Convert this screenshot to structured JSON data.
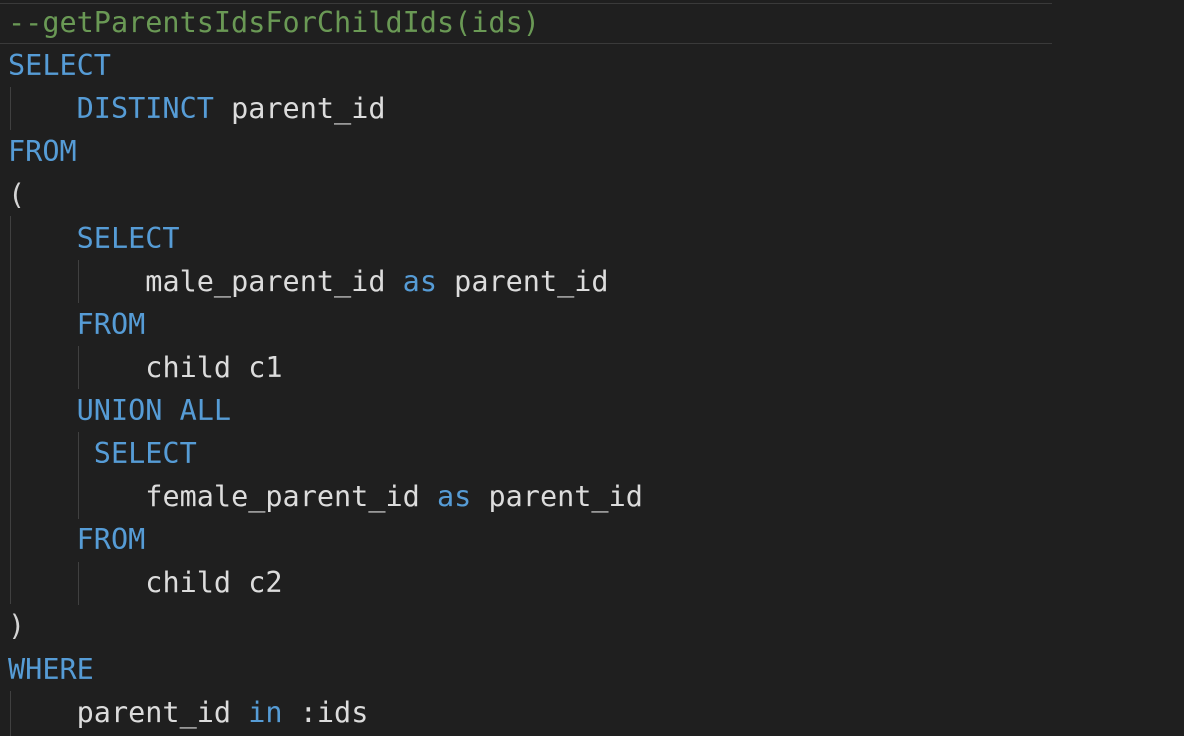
{
  "editor": {
    "language": "sql",
    "colors": {
      "background": "#1f1f1f",
      "keyword": "#569cd6",
      "comment": "#6a9955",
      "identifier": "#dcdcdc",
      "indent_guide": "#404040"
    },
    "lines": [
      {
        "tokens": [
          {
            "type": "comment",
            "text": "--getParentsIdsForChildIds(ids)"
          }
        ]
      },
      {
        "tokens": [
          {
            "type": "kw",
            "text": "SELECT"
          }
        ]
      },
      {
        "tokens": [
          {
            "type": "ws",
            "text": "    "
          },
          {
            "type": "kw",
            "text": "DISTINCT"
          },
          {
            "type": "id",
            "text": " parent_id"
          }
        ]
      },
      {
        "tokens": [
          {
            "type": "kw",
            "text": "FROM"
          }
        ]
      },
      {
        "tokens": [
          {
            "type": "punc",
            "text": "("
          }
        ]
      },
      {
        "tokens": [
          {
            "type": "ws",
            "text": "    "
          },
          {
            "type": "kw",
            "text": "SELECT"
          }
        ]
      },
      {
        "tokens": [
          {
            "type": "ws",
            "text": "        "
          },
          {
            "type": "id",
            "text": "male_parent_id "
          },
          {
            "type": "kw",
            "text": "as"
          },
          {
            "type": "id",
            "text": " parent_id"
          }
        ]
      },
      {
        "tokens": [
          {
            "type": "ws",
            "text": "    "
          },
          {
            "type": "kw",
            "text": "FROM"
          }
        ]
      },
      {
        "tokens": [
          {
            "type": "ws",
            "text": "        "
          },
          {
            "type": "id",
            "text": "child c1"
          }
        ]
      },
      {
        "tokens": [
          {
            "type": "ws",
            "text": "    "
          },
          {
            "type": "kw",
            "text": "UNION ALL"
          }
        ]
      },
      {
        "tokens": [
          {
            "type": "ws",
            "text": "     "
          },
          {
            "type": "kw",
            "text": "SELECT"
          }
        ]
      },
      {
        "tokens": [
          {
            "type": "ws",
            "text": "        "
          },
          {
            "type": "id",
            "text": "female_parent_id "
          },
          {
            "type": "kw",
            "text": "as"
          },
          {
            "type": "id",
            "text": " parent_id"
          }
        ]
      },
      {
        "tokens": [
          {
            "type": "ws",
            "text": "    "
          },
          {
            "type": "kw",
            "text": "FROM"
          }
        ]
      },
      {
        "tokens": [
          {
            "type": "ws",
            "text": "        "
          },
          {
            "type": "id",
            "text": "child c2"
          }
        ]
      },
      {
        "tokens": [
          {
            "type": "punc",
            "text": ")"
          }
        ]
      },
      {
        "tokens": [
          {
            "type": "kw",
            "text": "WHERE"
          }
        ]
      },
      {
        "tokens": [
          {
            "type": "ws",
            "text": "    "
          },
          {
            "type": "id",
            "text": "parent_id "
          },
          {
            "type": "kw",
            "text": "in"
          },
          {
            "type": "id",
            "text": " :ids"
          }
        ]
      }
    ]
  }
}
